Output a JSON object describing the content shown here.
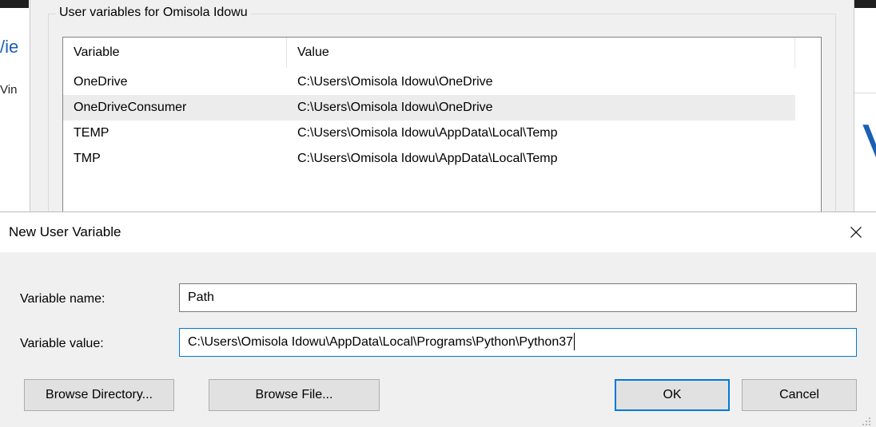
{
  "background": {
    "left_fragment_top": "/ie",
    "left_fragment_bottom": "Vin",
    "right_fragment": "V"
  },
  "env_dialog": {
    "group_title": "User variables for Omisola Idowu",
    "columns": [
      "Variable",
      "Value"
    ],
    "rows": [
      {
        "variable": "OneDrive",
        "value": "C:\\Users\\Omisola Idowu\\OneDrive",
        "selected": false
      },
      {
        "variable": "OneDriveConsumer",
        "value": "C:\\Users\\Omisola Idowu\\OneDrive",
        "selected": true
      },
      {
        "variable": "TEMP",
        "value": "C:\\Users\\Omisola Idowu\\AppData\\Local\\Temp",
        "selected": false
      },
      {
        "variable": "TMP",
        "value": "C:\\Users\\Omisola Idowu\\AppData\\Local\\Temp",
        "selected": false
      }
    ]
  },
  "new_var_dialog": {
    "title": "New User Variable",
    "close_icon": "close-icon",
    "name_label": "Variable name:",
    "name_value": "Path",
    "value_label": "Variable value:",
    "value_value": "C:\\Users\\Omisola Idowu\\AppData\\Local\\Programs\\Python\\Python37",
    "browse_directory_label": "Browse Directory...",
    "browse_file_label": "Browse File...",
    "ok_label": "OK",
    "cancel_label": "Cancel"
  },
  "colors": {
    "accent": "#0078d7",
    "dialog_bg": "#f0f0f0",
    "button_bg": "#e1e1e1",
    "selection_bg": "#ececec"
  }
}
